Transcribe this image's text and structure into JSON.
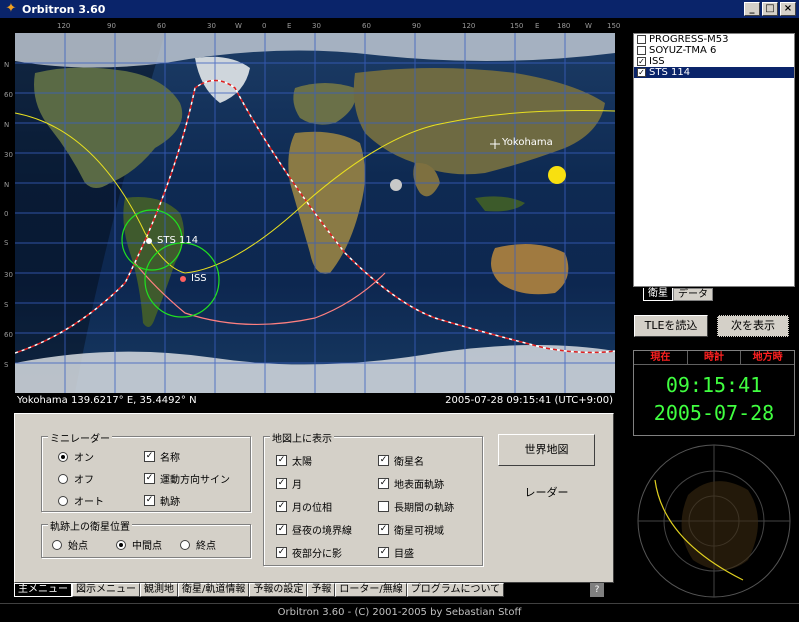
{
  "window": {
    "title": "Orbitron 3.60"
  },
  "map": {
    "lon_labels": [
      "120",
      "90",
      "60",
      "30",
      "W",
      "0",
      "E",
      "30",
      "60",
      "90",
      "120",
      "150",
      "E",
      "180",
      "W",
      "150"
    ],
    "lat_labels": [
      "N",
      "60",
      "N",
      "30",
      "N",
      "0",
      "S",
      "30",
      "S",
      "60",
      "S"
    ],
    "location_label": "Yokohama",
    "sat_labels": [
      "STS 114",
      "ISS"
    ],
    "status_left": "Yokohama 139.6217° E, 35.4492° N",
    "status_right": "2005-07-28 09:15:41 (UTC+9:00)"
  },
  "satellites": [
    {
      "name": "PROGRESS-M53",
      "checked": false,
      "selected": false
    },
    {
      "name": "SOYUZ-TMA 6",
      "checked": false,
      "selected": false
    },
    {
      "name": "ISS",
      "checked": true,
      "selected": false
    },
    {
      "name": "STS 114",
      "checked": true,
      "selected": true
    }
  ],
  "side_tabs": {
    "satellites": "衛星",
    "data": "データ"
  },
  "buttons": {
    "tle_load": "TLEを読込",
    "show_next": "次を表示",
    "world_map": "世界地図",
    "radar": "レーダー"
  },
  "clock": {
    "now": "現在",
    "clock": "時計",
    "local": "地方時",
    "time": "09:15:41",
    "date": "2005-07-28"
  },
  "mini_radar": {
    "title": "ミニレーダー",
    "on": "オン",
    "off": "オフ",
    "auto": "オート",
    "name": "名称",
    "direction": "運動方向サイン",
    "track": "軌跡"
  },
  "track_pos": {
    "title": "軌跡上の衛星位置",
    "start": "始点",
    "middle": "中間点",
    "end": "終点"
  },
  "map_display": {
    "title": "地図上に表示",
    "sun": "太陽",
    "moon": "月",
    "moon_phase": "月の位相",
    "terminator": "昼夜の境界線",
    "night_shadow": "夜部分に影",
    "sat_name": "衛星名",
    "ground_track": "地表面軌跡",
    "long_track": "長期間の軌跡",
    "visibility": "衛星可視域",
    "grid": "目盛"
  },
  "bottom_tabs": [
    "主メニュー",
    "図示メニュー",
    "観測地",
    "衛星/軌道情報",
    "予報の設定",
    "予報",
    "ローター/無線",
    "プログラムについて"
  ],
  "help": "?",
  "statusbar": "Orbitron 3.60 - (C) 2001-2005 by Sebastian Stoff"
}
